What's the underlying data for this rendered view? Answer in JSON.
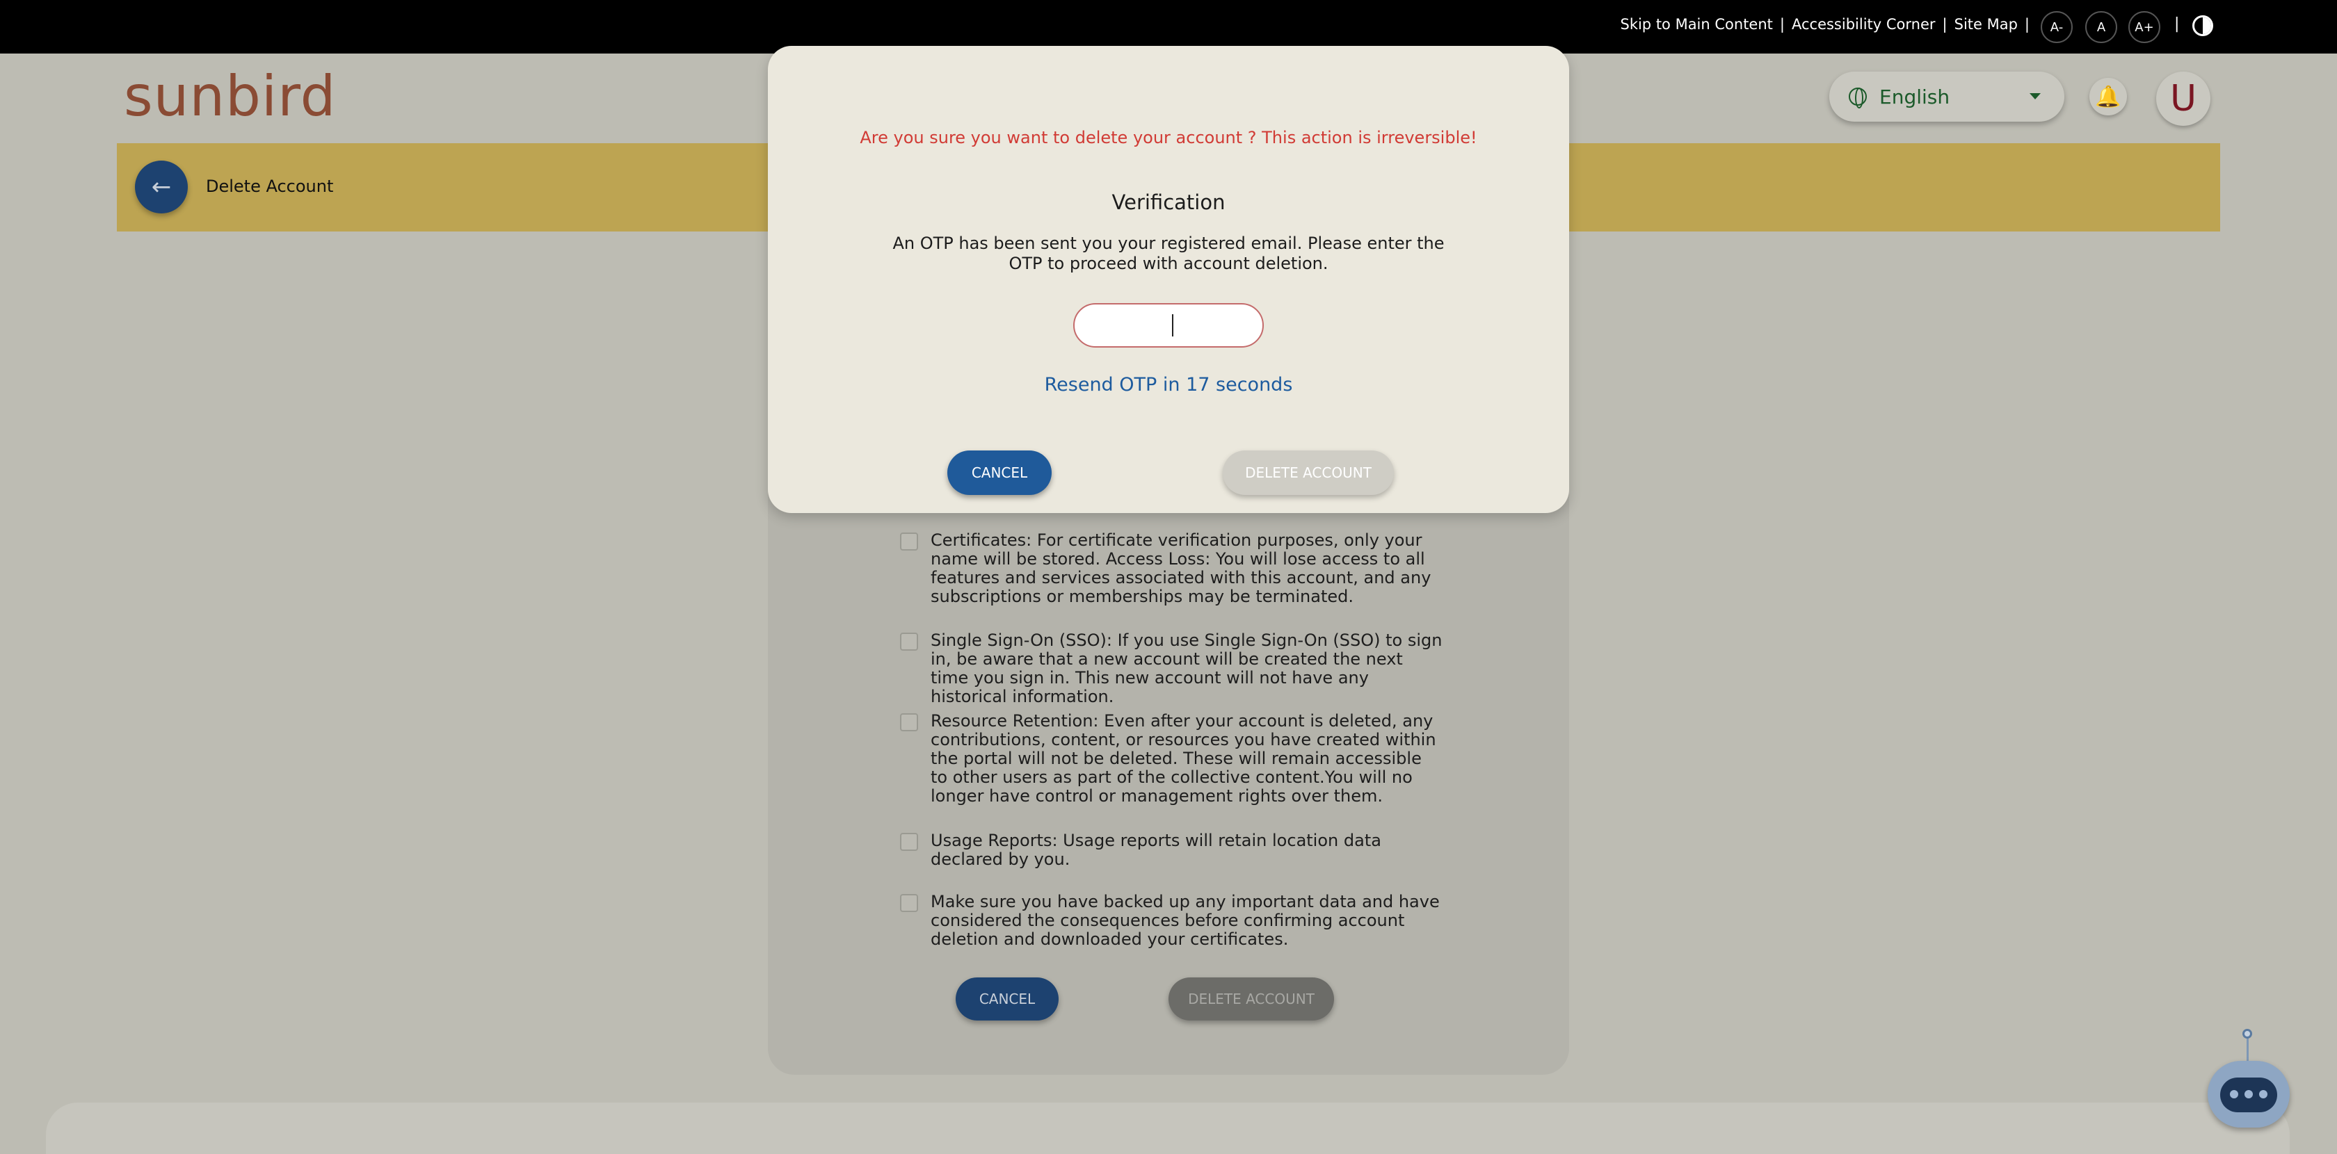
{
  "topbar": {
    "skip_link": "Skip to Main Content",
    "accessibility_link": "Accessibility Corner",
    "sitemap_link": "Site Map",
    "separator": "|",
    "font_decrease": "A-",
    "font_reset": "A",
    "font_increase": "A+"
  },
  "header": {
    "logo_text": "sunbird",
    "language": "English",
    "avatar_initial": "U"
  },
  "page": {
    "title": "Delete Account"
  },
  "modal": {
    "warning": "Are you sure you want to delete your account ? This action is irreversible!",
    "title": "Verification",
    "message": "An OTP has been sent you your registered email. Please enter the OTP to proceed with account deletion.",
    "otp_value": "",
    "resend_text": "Resend OTP in 17 seconds",
    "cancel_label": "CANCEL",
    "delete_label": "DELETE ACCOUNT"
  },
  "conditions": [
    {
      "text": "Certificates: For certificate verification purposes, only your name will be stored. Access Loss: You will lose access to all features and services associated with this account, and any subscriptions or memberships may be terminated."
    },
    {
      "text": "Single Sign-On (SSO): If you use Single Sign-On (SSO) to sign in, be aware that a new account will be created the next time you sign in. This new account will not have any historical information."
    },
    {
      "text": "Resource Retention: Even after your account is deleted, any contributions, content, or resources you have created within the portal will not be deleted. These will remain accessible to other users as part of the collective content.You will no longer have control or management rights over them."
    },
    {
      "text": "Usage Reports: Usage reports will retain location data declared by you."
    },
    {
      "text": "Make sure you have backed up any important data and have considered the consequences before confirming account deletion and downloaded your certificates."
    }
  ],
  "card_buttons": {
    "cancel_label": "CANCEL",
    "delete_label": "DELETE ACCOUNT"
  },
  "colors": {
    "primary": "#1f5a9a",
    "warning": "#d13b35",
    "header_band": "#bda452"
  }
}
